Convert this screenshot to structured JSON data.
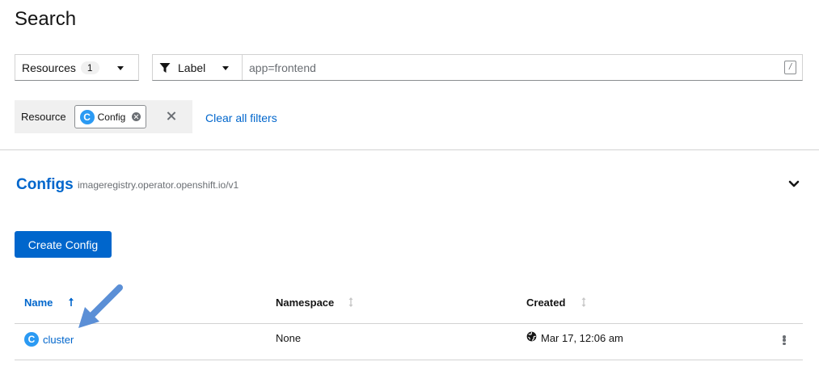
{
  "page": {
    "title": "Search"
  },
  "toolbar": {
    "resources_label": "Resources",
    "resources_count": "1",
    "label_dropdown": "Label",
    "search_placeholder": "app=frontend",
    "search_value": "",
    "shortcut_key": "/"
  },
  "filters": {
    "group_label": "Resource",
    "chip_badge": "C",
    "chip_label": "Config",
    "clear_all": "Clear all filters"
  },
  "section": {
    "title": "Configs",
    "api_group": "imageregistry.operator.openshift.io/v1",
    "create_button": "Create Config"
  },
  "table": {
    "columns": [
      "Name",
      "Namespace",
      "Created"
    ],
    "rows": [
      {
        "badge": "C",
        "name": "cluster",
        "namespace": "None",
        "created": "Mar 17, 12:06 am"
      }
    ]
  },
  "colors": {
    "link": "#0066cc",
    "primary_button": "#0066cc",
    "resource_badge": "#2b9af3",
    "annotation_arrow": "#5b8fd6"
  },
  "icons": [
    "filter-icon",
    "chevron-down-icon",
    "close-icon",
    "sort-icon",
    "globe-icon",
    "kebab-icon",
    "arrow-annotation"
  ]
}
